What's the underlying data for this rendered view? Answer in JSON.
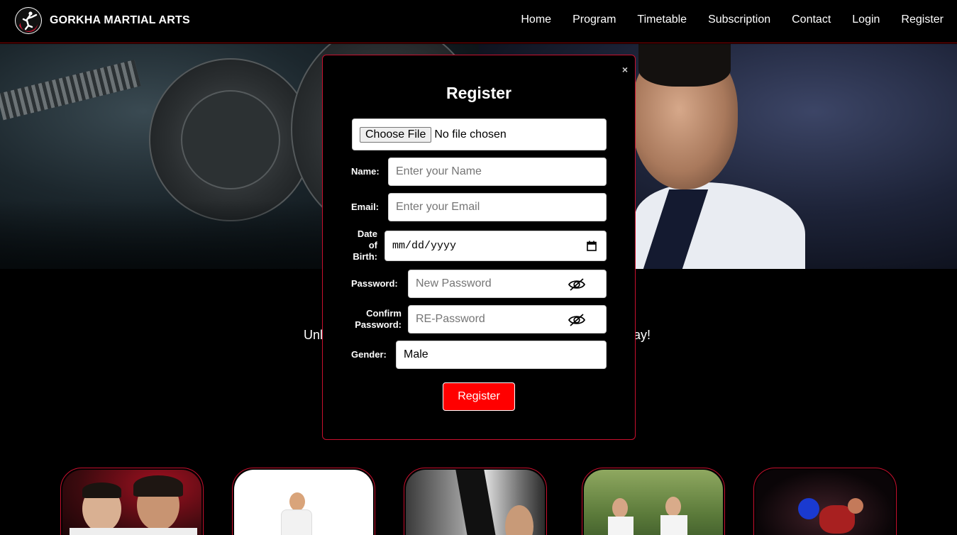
{
  "navbar": {
    "brand": "GORKHA MARTIAL ARTS",
    "links": [
      "Home",
      "Program",
      "Timetable",
      "Subscription",
      "Contact",
      "Login",
      "Register"
    ]
  },
  "page": {
    "tagline_left": "Unl",
    "tagline_right": "ay!"
  },
  "modal": {
    "title": "Register",
    "close": "×",
    "file": {
      "button": "Choose File",
      "status": "No file chosen"
    },
    "name": {
      "label": "Name:",
      "placeholder": "Enter your Name"
    },
    "email": {
      "label": "Email:",
      "placeholder": "Enter your Email"
    },
    "dob": {
      "label": "Date of Birth:",
      "value": "mm/dd/yyyy"
    },
    "password": {
      "label": "Password:",
      "placeholder": "New Password"
    },
    "confirm": {
      "label": "Confirm Password:",
      "placeholder": "RE-Password"
    },
    "gender": {
      "label": "Gender:",
      "value": "Male"
    },
    "submit": "Register"
  },
  "colors": {
    "accent": "#ff0000",
    "border": "#c8102e",
    "background": "#000000"
  },
  "icons": [
    "logo-icon",
    "close-icon",
    "eye-slash-icon",
    "calendar-icon"
  ]
}
